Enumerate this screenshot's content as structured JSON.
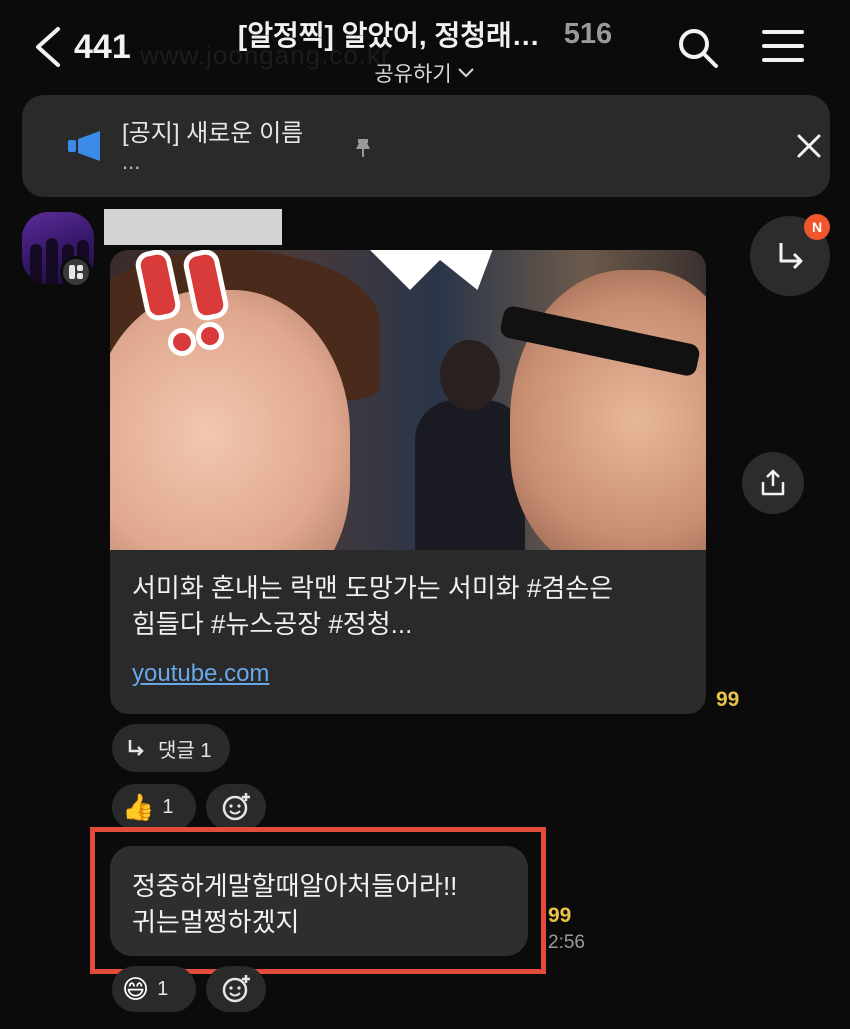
{
  "header": {
    "back_count": "441",
    "title": "[알정찍] 알았어, 정청래…",
    "member_count": "516",
    "share_label": "공유하기",
    "watermark": "www.joongang.co.kr"
  },
  "notice": {
    "text": "[공지] 새로운 이름",
    "more": "..."
  },
  "message1": {
    "link_title_line1": "서미화 혼내는 락맨 도망가는 서미화 #겸손은",
    "link_title_line2": "힘들다 #뉴스공장 #정청...",
    "link_domain": "youtube.com",
    "unread": "99",
    "comment_label": "댓글 1",
    "reaction_count": "1",
    "reaction_emoji": "👍"
  },
  "message2": {
    "line1": "정중하게말할때알아처들어라!!",
    "line2": "귀는멀쩡하겠지",
    "unread": "99",
    "time": "2:56",
    "reaction_count": "1",
    "reaction_emoji": "😄"
  },
  "reply_badge": "N",
  "colors": {
    "background": "#0b0b0b",
    "bubble": "#2e2e2e",
    "unread": "#e8c34a",
    "highlight": "#e34b3b",
    "link": "#6aa7e8",
    "badge": "#f0552d"
  }
}
